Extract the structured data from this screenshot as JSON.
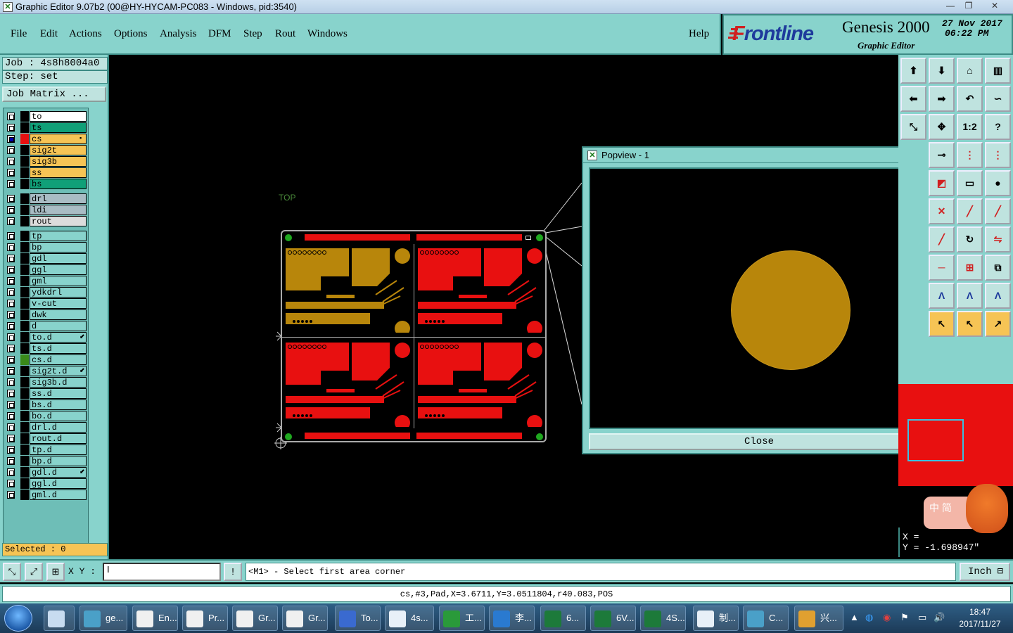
{
  "window": {
    "title": "Graphic Editor 9.07b2 (00@HY-HYCAM-PC083 - Windows, pid:3540)",
    "min": "—",
    "max": "❐",
    "close": "✕"
  },
  "menubar": {
    "items": [
      "File",
      "Edit",
      "Actions",
      "Options",
      "Analysis",
      "DFM",
      "Step",
      "Rout",
      "Windows"
    ],
    "help": "Help"
  },
  "logo": {
    "brand": "Frontline",
    "product": "Genesis 2000",
    "subtitle": "Graphic Editor",
    "date": "27 Nov 2017",
    "time": "06:22 PM"
  },
  "left_panel": {
    "job": "Job : 4s8h8004a0",
    "step": "Step: set",
    "job_matrix": "Job Matrix ...",
    "selected": "Selected : 0",
    "layers": [
      {
        "name": "to",
        "color": "#ffffff",
        "affected": false,
        "checked": false,
        "aff_color": "#000000"
      },
      {
        "name": "ts",
        "color": "#10a078",
        "affected": false,
        "checked": false,
        "aff_color": "#000000"
      },
      {
        "name": "cs",
        "color": "#f6c455",
        "affected": true,
        "checked": true,
        "aff_color": "#e81010",
        "mark": "▪"
      },
      {
        "name": "sig2t",
        "color": "#f6c455",
        "affected": false,
        "checked": false,
        "aff_color": "#000000"
      },
      {
        "name": "sig3b",
        "color": "#f6c455",
        "affected": false,
        "checked": false,
        "aff_color": "#000000"
      },
      {
        "name": "ss",
        "color": "#f6c455",
        "affected": false,
        "checked": false,
        "aff_color": "#000000"
      },
      {
        "name": "bs",
        "color": "#10a078",
        "affected": false,
        "checked": false,
        "aff_color": "#000000"
      },
      {
        "name": "drl",
        "color": "#a9bcc4",
        "affected": false,
        "checked": false,
        "aff_color": "#000000"
      },
      {
        "name": "ldi",
        "color": "#a9bcc4",
        "affected": false,
        "checked": false,
        "aff_color": "#000000"
      },
      {
        "name": "rout",
        "color": "#dcdcdc",
        "affected": false,
        "checked": false,
        "aff_color": "#000000"
      },
      {
        "name": "tp",
        "color": "#88d3cc",
        "affected": false,
        "checked": false,
        "aff_color": "#000000"
      },
      {
        "name": "bp",
        "color": "#88d3cc",
        "affected": false,
        "checked": false,
        "aff_color": "#000000"
      },
      {
        "name": "gdl",
        "color": "#88d3cc",
        "affected": false,
        "checked": false,
        "aff_color": "#000000"
      },
      {
        "name": "ggl",
        "color": "#88d3cc",
        "affected": false,
        "checked": false,
        "aff_color": "#000000"
      },
      {
        "name": "gml",
        "color": "#88d3cc",
        "affected": false,
        "checked": false,
        "aff_color": "#000000"
      },
      {
        "name": "ydkdrl",
        "color": "#88d3cc",
        "affected": false,
        "checked": false,
        "aff_color": "#000000"
      },
      {
        "name": "v-cut",
        "color": "#88d3cc",
        "affected": false,
        "checked": false,
        "aff_color": "#000000"
      },
      {
        "name": "dwk",
        "color": "#88d3cc",
        "affected": false,
        "checked": false,
        "aff_color": "#000000"
      },
      {
        "name": "d",
        "color": "#88d3cc",
        "affected": false,
        "checked": false,
        "aff_color": "#000000"
      },
      {
        "name": "to.d",
        "color": "#88d3cc",
        "affected": false,
        "checked": false,
        "aff_color": "#000000",
        "mark": "⬋"
      },
      {
        "name": "ts.d",
        "color": "#88d3cc",
        "affected": false,
        "checked": false,
        "aff_color": "#000000"
      },
      {
        "name": "cs.d",
        "color": "#88d3cc",
        "affected": false,
        "checked": false,
        "aff_color": "#3a8a1a"
      },
      {
        "name": "sig2t.d",
        "color": "#88d3cc",
        "affected": false,
        "checked": false,
        "aff_color": "#000000",
        "mark": "⬋"
      },
      {
        "name": "sig3b.d",
        "color": "#88d3cc",
        "affected": false,
        "checked": false,
        "aff_color": "#000000"
      },
      {
        "name": "ss.d",
        "color": "#88d3cc",
        "affected": false,
        "checked": false,
        "aff_color": "#000000"
      },
      {
        "name": "bs.d",
        "color": "#88d3cc",
        "affected": false,
        "checked": false,
        "aff_color": "#000000"
      },
      {
        "name": "bo.d",
        "color": "#88d3cc",
        "affected": false,
        "checked": false,
        "aff_color": "#000000"
      },
      {
        "name": "drl.d",
        "color": "#88d3cc",
        "affected": false,
        "checked": false,
        "aff_color": "#000000"
      },
      {
        "name": "rout.d",
        "color": "#88d3cc",
        "affected": false,
        "checked": false,
        "aff_color": "#000000"
      },
      {
        "name": "tp.d",
        "color": "#88d3cc",
        "affected": false,
        "checked": false,
        "aff_color": "#000000"
      },
      {
        "name": "bp.d",
        "color": "#88d3cc",
        "affected": false,
        "checked": false,
        "aff_color": "#000000"
      },
      {
        "name": "gdl.d",
        "color": "#88d3cc",
        "affected": false,
        "checked": false,
        "aff_color": "#000000",
        "mark": "⬋"
      },
      {
        "name": "ggl.d",
        "color": "#88d3cc",
        "affected": false,
        "checked": false,
        "aff_color": "#000000"
      },
      {
        "name": "gml.d",
        "color": "#88d3cc",
        "affected": false,
        "checked": false,
        "aff_color": "#000000"
      }
    ]
  },
  "canvas": {
    "top_label": "TOP",
    "colors": {
      "gold": "#b8860b",
      "red": "#e81010",
      "green": "#1fa81f"
    }
  },
  "popview": {
    "title": "Popview - 1",
    "close_x": "✕",
    "close_button": "Close"
  },
  "coords": {
    "x": "X = ",
    "y": "Y = -1.698947\""
  },
  "command_bar": {
    "xy_label": "X Y :",
    "xy_value": "I",
    "bang": "!",
    "prompt": "<M1> - Select first area corner",
    "unit": "Inch"
  },
  "status": "cs,#3,Pad,X=3.6711,Y=3.0511804,r40.083,POS",
  "ime": {
    "text": "中 简"
  },
  "taskbar": {
    "items": [
      {
        "label": "",
        "icon_color": "#c8dcf0",
        "icon": "calculator-icon"
      },
      {
        "label": "ge...",
        "icon_color": "#4aa0c8",
        "icon": "eye-icon"
      },
      {
        "label": "En...",
        "icon_color": "#f0f0f0",
        "icon": "x-window-icon"
      },
      {
        "label": "Pr...",
        "icon_color": "#f0f0f0",
        "icon": "x-window-icon"
      },
      {
        "label": "Gr...",
        "icon_color": "#f0f0f0",
        "icon": "x-window-icon"
      },
      {
        "label": "Gr...",
        "icon_color": "#f0f0f0",
        "icon": "x-window-icon"
      },
      {
        "label": "To...",
        "icon_color": "#3a6ad0",
        "icon": "floppy-icon"
      },
      {
        "label": "4s...",
        "icon_color": "#e8f0f8",
        "icon": "document-icon"
      },
      {
        "label": "工...",
        "icon_color": "#2a9a3a",
        "icon": "p-app-icon"
      },
      {
        "label": "李...",
        "icon_color": "#2a7ad0",
        "icon": "f-app-icon"
      },
      {
        "label": "6...",
        "icon_color": "#1d7a3a",
        "icon": "excel-icon"
      },
      {
        "label": "6V...",
        "icon_color": "#1d7a3a",
        "icon": "excel-icon"
      },
      {
        "label": "4S...",
        "icon_color": "#1d7a3a",
        "icon": "excel-icon"
      },
      {
        "label": "制...",
        "icon_color": "#e8f0f8",
        "icon": "notepad-icon"
      },
      {
        "label": "C...",
        "icon_color": "#4aa0c8",
        "icon": "network-icon"
      },
      {
        "label": "兴...",
        "icon_color": "#e0a030",
        "icon": "shell-icon"
      }
    ],
    "clock_time": "18:47",
    "clock_date": "2017/11/27"
  }
}
